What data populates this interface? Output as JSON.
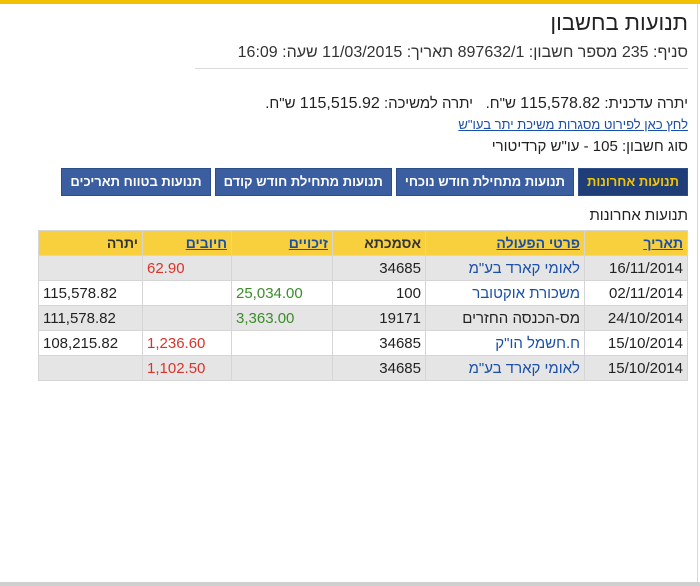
{
  "header": {
    "title": "תנועות בחשבון",
    "meta": "סניף: 235 מספר חשבון: 897632/1 תאריך: 11/03/2015 שעה: 16:09"
  },
  "balances": {
    "current_label": "יתרה עדכנית:",
    "current_value": "115,578.82",
    "current_unit": "ש\"ח.",
    "withdraw_label": "יתרה למשיכה:",
    "withdraw_value": "115,515.92",
    "withdraw_unit": "ש\"ח.",
    "credit_link": "לחץ כאן לפירוט מסגרות משיכת יתר בעו\"ש",
    "account_type": "סוג חשבון: 105 - עו\"ש קרדיטורי"
  },
  "tabs": [
    {
      "label": "תנועות אחרונות",
      "active": true
    },
    {
      "label": "תנועות מתחילת חודש נוכחי",
      "active": false
    },
    {
      "label": "תנועות מתחילת חודש קודם",
      "active": false
    },
    {
      "label": "תנועות בטווח תאריכים",
      "active": false
    }
  ],
  "section_title": "תנועות אחרונות",
  "table": {
    "headers": {
      "date": "תאריך",
      "description": "פרטי הפעולה",
      "reference": "אסמכתא",
      "credits": "זיכויים",
      "debits": "חיובים",
      "balance": "יתרה"
    },
    "rows": [
      {
        "date": "16/11/2014",
        "description": "לאומי קארד בע\"מ",
        "reference": "34685",
        "credit": "",
        "debit": "62.90",
        "balance": "",
        "desc_link": true
      },
      {
        "date": "02/11/2014",
        "description": "משכורת אוקטובר",
        "reference": "100",
        "credit": "25,034.00",
        "debit": "",
        "balance": "115,578.82",
        "desc_link": true
      },
      {
        "date": "24/10/2014",
        "description": "מס-הכנסה החזרים",
        "reference": "19171",
        "credit": "3,363.00",
        "debit": "",
        "balance": "111,578.82",
        "desc_link": false
      },
      {
        "date": "15/10/2014",
        "description": "ח.חשמל הו\"ק",
        "reference": "34685",
        "credit": "",
        "debit": "1,236.60",
        "balance": "108,215.82",
        "desc_link": true
      },
      {
        "date": "15/10/2014",
        "description": "לאומי קארד בע\"מ",
        "reference": "34685",
        "credit": "",
        "debit": "1,102.50",
        "balance": "",
        "desc_link": true
      }
    ]
  },
  "colors": {
    "accent_yellow": "#f2c200",
    "tab_blue": "#3b5ea0",
    "link_blue": "#1a4fa8",
    "credit_green": "#3c8c2b",
    "debit_red": "#d9342b"
  }
}
